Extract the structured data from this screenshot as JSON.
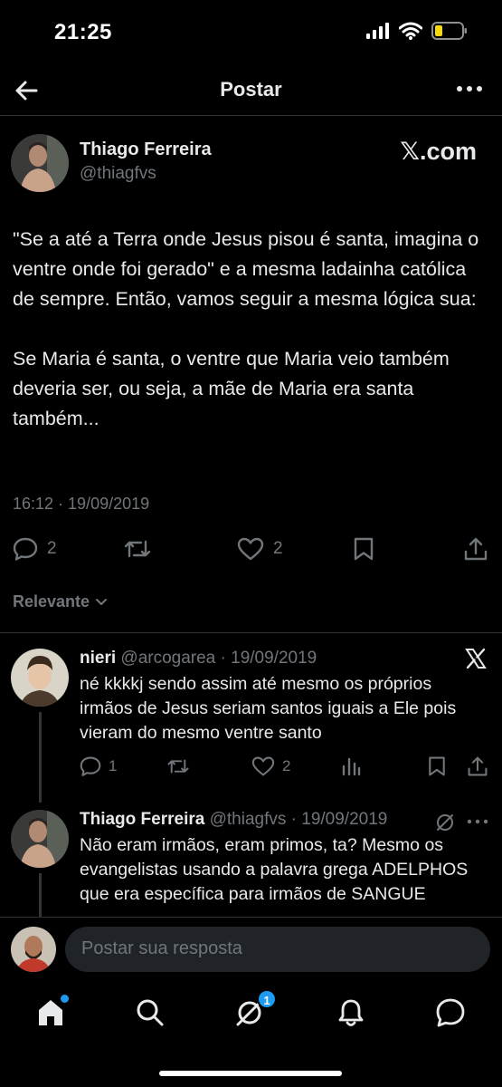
{
  "status_bar": {
    "time": "21:25"
  },
  "nav": {
    "title": "Postar"
  },
  "post": {
    "author_name": "Thiago Ferreira",
    "author_handle": "@thiagfvs",
    "source": "𝕏.com",
    "paragraph1": "\"Se a até a Terra onde Jesus pisou é santa, imagina o ventre onde foi gerado\" e a mesma ladainha católica de sempre. Então, vamos seguir a mesma lógica sua:",
    "paragraph2": "Se Maria é santa, o ventre que Maria veio também deveria ser, ou seja, a mãe de Maria era santa também...",
    "timestamp": "16:12 · 19/09/2019",
    "replies": "2",
    "likes": "2"
  },
  "sort": {
    "label": "Relevante"
  },
  "replies": [
    {
      "name": "nieri",
      "meta": "@arcogarea · 19/09/2019",
      "text": "né kkkkj sendo assim até mesmo os próprios irmãos de Jesus seriam santos iguais a Ele pois vieram do mesmo ventre santo",
      "reply_count": "1",
      "like_count": "2"
    },
    {
      "name": "Thiago Ferreira",
      "meta": "@thiagfvs · 19/09/2019",
      "text": "Não eram irmãos, eram primos, ta? Mesmo os evangelistas usando a palavra grega ADELPHOS que era específica para irmãos de SANGUE"
    }
  ],
  "composer": {
    "placeholder": "Postar sua resposta"
  },
  "tabs": {
    "messages_badge": "1"
  },
  "colors": {
    "background": "#000000",
    "text": "#e7e9ea",
    "muted": "#71767b",
    "accent": "#1d9bf0",
    "divider": "#2f3336"
  }
}
